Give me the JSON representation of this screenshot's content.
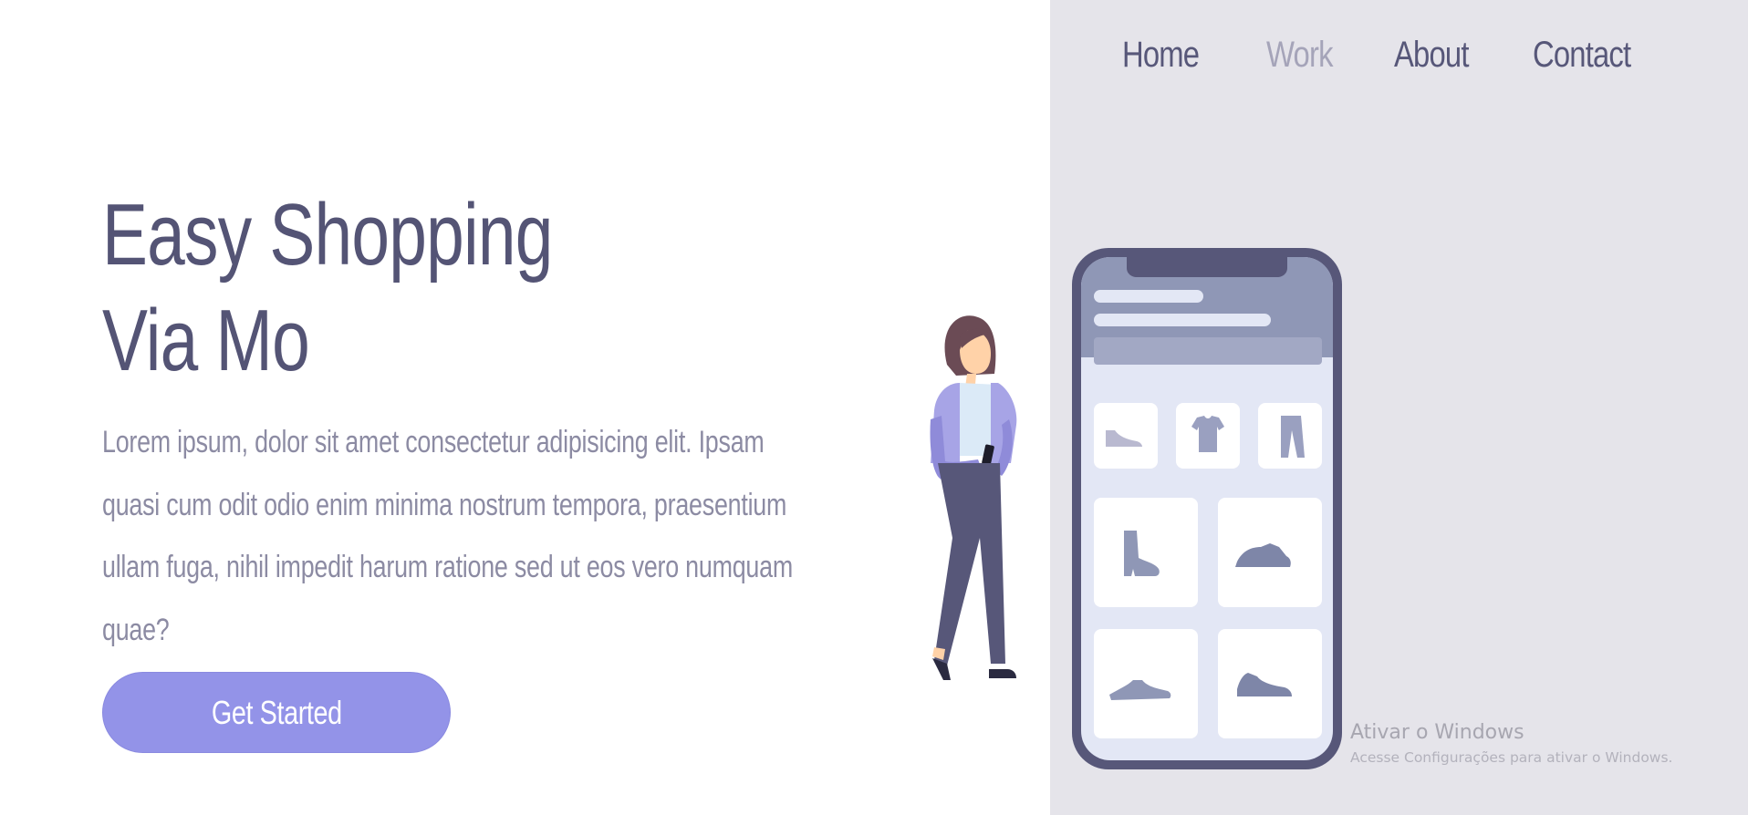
{
  "nav": {
    "items": [
      {
        "label": "Home",
        "active": false
      },
      {
        "label": "Work",
        "active": true
      },
      {
        "label": "About",
        "active": false
      },
      {
        "label": "Contact",
        "active": false
      }
    ]
  },
  "hero": {
    "title_line1": "Easy Shopping",
    "title_line2": "Via Mo",
    "description": "Lorem ipsum, dolor sit amet consectetur adipisicing elit. Ipsam quasi cum odit odio enim minima nostrum tempora, praesentium ullam fuga, nihil impedit harum ratione sed ut eos vero numquam quae?",
    "cta_label": "Get Started"
  },
  "illustration": {
    "icons": [
      "shoe-icon",
      "tshirt-icon",
      "pants-icon",
      "boot-icon",
      "sneaker-icon",
      "flat-shoe-icon",
      "running-shoe-icon"
    ]
  },
  "watermark": {
    "title": "Ativar o Windows",
    "subtitle": "Acesse Configurações para ativar o Windows."
  },
  "colors": {
    "title": "#545475",
    "text": "#8c8ba3",
    "accent": "#9393e8",
    "panel": "#e5e4ea",
    "nav_active": "#a5a4b9",
    "nav": "#575779"
  }
}
